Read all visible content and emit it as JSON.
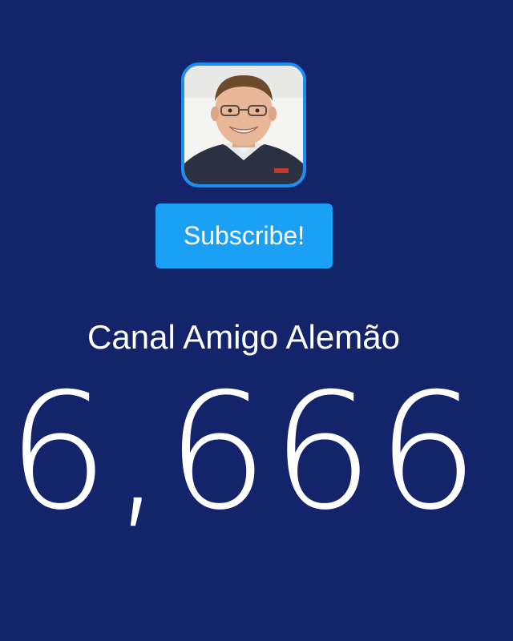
{
  "channel": {
    "avatar_icon": "profile-photo",
    "subscribe_label": "Subscribe!",
    "name": "Canal Amigo Alemão",
    "subscriber_count": "6,666"
  },
  "colors": {
    "background": "#13246a",
    "button": "#1aa0f5",
    "avatar_border": "#1f8cf0",
    "text": "#ffffff"
  }
}
